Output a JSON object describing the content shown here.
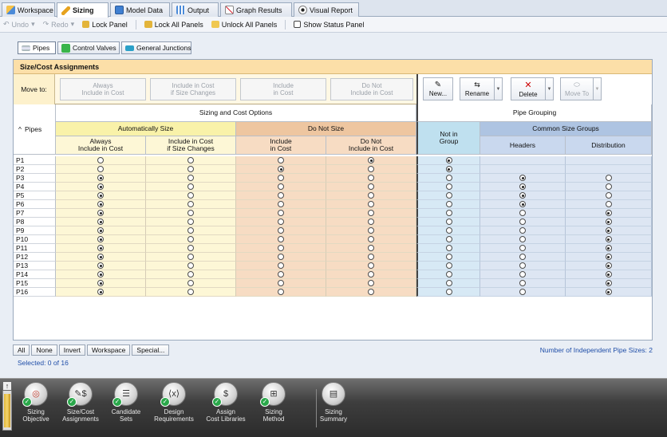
{
  "tabs": [
    {
      "label": "Workspace",
      "icon": "workspace-icon"
    },
    {
      "label": "Sizing",
      "icon": "pencil-icon"
    },
    {
      "label": "Model Data",
      "icon": "table-icon"
    },
    {
      "label": "Output",
      "icon": "grid-icon"
    },
    {
      "label": "Graph Results",
      "icon": "chart-icon"
    },
    {
      "label": "Visual Report",
      "icon": "eye-icon"
    }
  ],
  "toolbar": {
    "undo": "Undo",
    "redo": "Redo",
    "lock_panel": "Lock Panel",
    "lock_all": "Lock All Panels",
    "unlock_all": "Unlock All Panels",
    "show_status": "Show Status Panel"
  },
  "subtabs": [
    {
      "label": "Pipes"
    },
    {
      "label": "Control Valves"
    },
    {
      "label": "General Junctions"
    }
  ],
  "panel": {
    "title": "Size/Cost Assignments",
    "move_to": "Move to:",
    "move_buttons": [
      "Always\nInclude in Cost",
      "Include in Cost\nif Size Changes",
      "Include\nin Cost",
      "Do Not\nInclude in Cost"
    ],
    "group_buttons": {
      "new": "New...",
      "rename": "Rename",
      "delete": "Delete",
      "move_to": "Move To"
    }
  },
  "grid": {
    "pipes_header": "Pipes",
    "sizing_header": "Sizing and Cost Options",
    "auto_header": "Automatically Size",
    "donot_header": "Do Not Size",
    "col_always": "Always\nInclude in Cost",
    "col_ifchange": "Include in Cost\nif Size Changes",
    "col_include": "Include\nin Cost",
    "col_donot": "Do Not\nInclude in Cost",
    "grouping_header": "Pipe Grouping",
    "notin_header": "Not in\nGroup",
    "common_header": "Common Size Groups",
    "headers_col": "Headers",
    "distribution_col": "Distribution"
  },
  "rows": [
    {
      "name": "P1",
      "sizing": 3,
      "group": 0
    },
    {
      "name": "P2",
      "sizing": 2,
      "group": 0
    },
    {
      "name": "P3",
      "sizing": 0,
      "group": 1
    },
    {
      "name": "P4",
      "sizing": 0,
      "group": 1
    },
    {
      "name": "P5",
      "sizing": 0,
      "group": 1
    },
    {
      "name": "P6",
      "sizing": 0,
      "group": 1
    },
    {
      "name": "P7",
      "sizing": 0,
      "group": 2
    },
    {
      "name": "P8",
      "sizing": 0,
      "group": 2
    },
    {
      "name": "P9",
      "sizing": 0,
      "group": 2
    },
    {
      "name": "P10",
      "sizing": 0,
      "group": 2
    },
    {
      "name": "P11",
      "sizing": 0,
      "group": 2
    },
    {
      "name": "P12",
      "sizing": 0,
      "group": 2
    },
    {
      "name": "P13",
      "sizing": 0,
      "group": 2
    },
    {
      "name": "P14",
      "sizing": 0,
      "group": 2
    },
    {
      "name": "P15",
      "sizing": 0,
      "group": 2
    },
    {
      "name": "P16",
      "sizing": 0,
      "group": 2
    }
  ],
  "bottom": {
    "buttons": [
      "All",
      "None",
      "Invert",
      "Workspace",
      "Special..."
    ],
    "selected": "Selected: 0 of 16",
    "num_sizes": "Number of Independent Pipe Sizes: 2"
  },
  "tray": [
    {
      "label": "Sizing\nObjective",
      "icon": "target-icon"
    },
    {
      "label": "Size/Cost\nAssignments",
      "icon": "dollar-pencil-icon"
    },
    {
      "label": "Candidate\nSets",
      "icon": "list-icon"
    },
    {
      "label": "Design\nRequirements",
      "icon": "variable-icon"
    },
    {
      "label": "Assign\nCost Libraries",
      "icon": "money-bag-icon"
    },
    {
      "label": "Sizing\nMethod",
      "icon": "network-icon"
    },
    {
      "label": "Sizing\nSummary",
      "icon": "summary-icon"
    }
  ],
  "colors": {
    "yellow": "#fdf7d6",
    "peach": "#f7dcc3",
    "blue": "#d7e9f5",
    "lavender": "#dde6f3",
    "title": "#fcdfa8",
    "green": "#2aa84a"
  }
}
